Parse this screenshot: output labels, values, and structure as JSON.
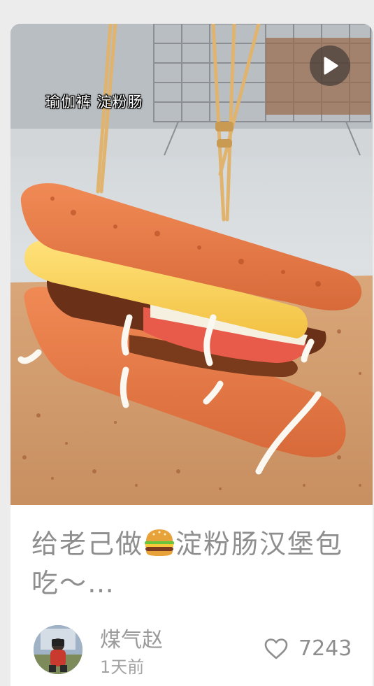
{
  "post": {
    "overlay_caption": "瑜伽裤 淀粉肠",
    "title_part1": "给老己做",
    "title_emoji": "hamburger-emoji",
    "title_part2": "淀粉肠汉堡包吃～…",
    "author_name": "煤气赵",
    "time_ago": "1天前",
    "like_count": "7243",
    "media_type": "video"
  },
  "icons": {
    "play": "play-icon",
    "like": "heart-outline-icon"
  },
  "colors": {
    "text_muted": "#8e8e8e",
    "card_bg": "#ffffff",
    "page_bg": "#ececec"
  }
}
